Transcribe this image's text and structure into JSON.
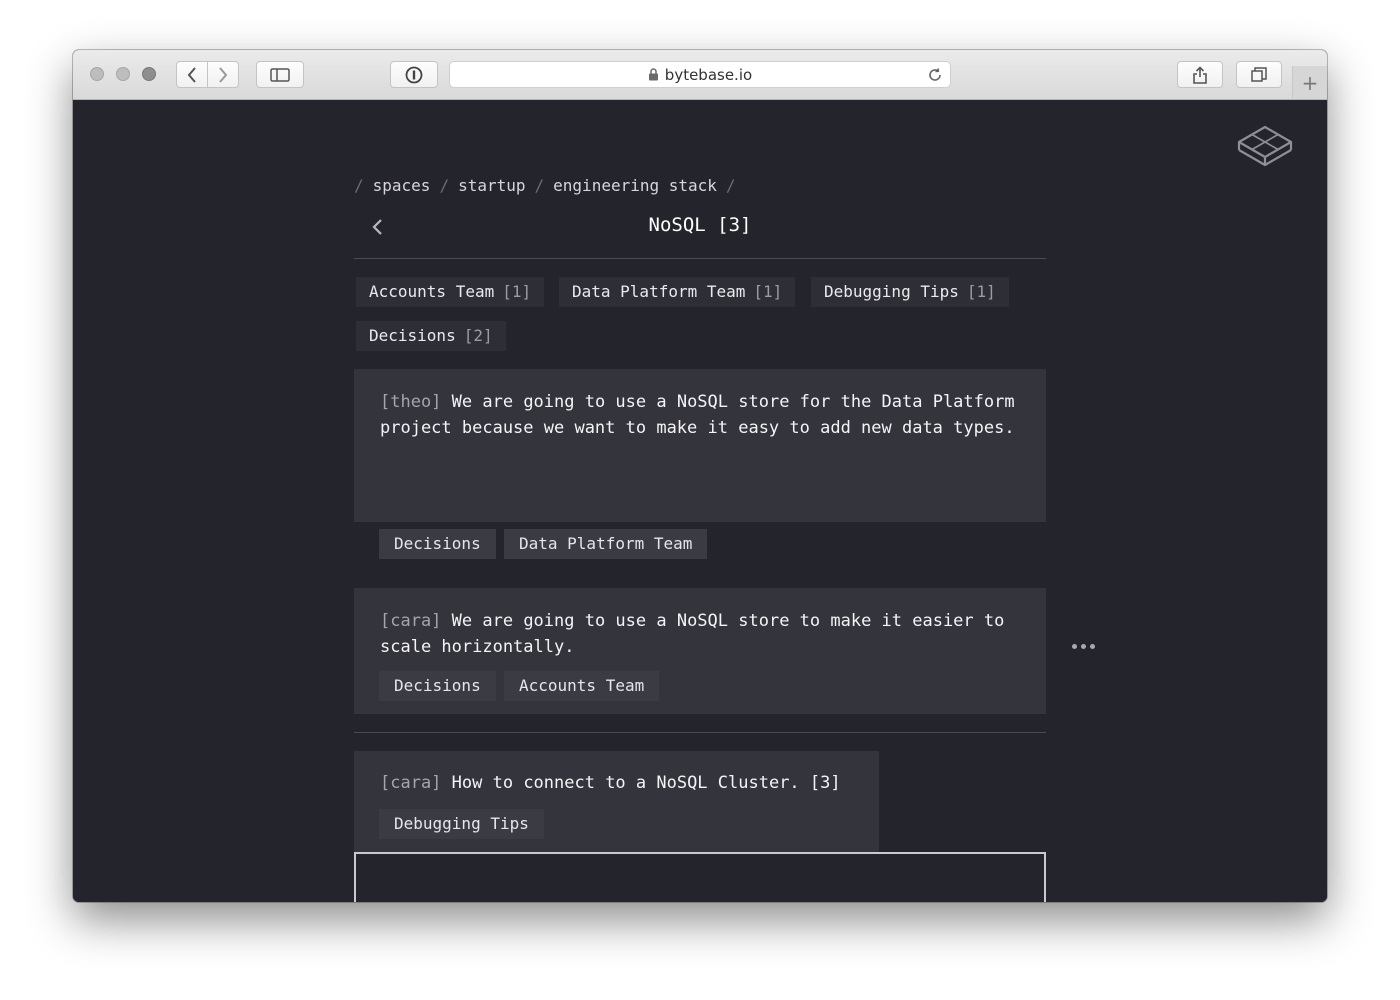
{
  "browser": {
    "url": "bytebase.io",
    "colors": {
      "toolbar": "#e3e3e3",
      "page_bg": "#24242d"
    }
  },
  "breadcrumb": [
    "spaces",
    "startup",
    "engineering stack"
  ],
  "page": {
    "title": "NoSQL [3]"
  },
  "filters": [
    {
      "label": "Accounts Team",
      "count": "[1]"
    },
    {
      "label": "Data Platform Team",
      "count": "[1]"
    },
    {
      "label": "Debugging Tips",
      "count": "[1]"
    },
    {
      "label": "Decisions",
      "count": "[2]"
    }
  ],
  "cards": [
    {
      "author": "[theo]",
      "text": "We are going to use a NoSQL store for the Data Platform project because we want to make it easy to add new data types.",
      "tags": [
        "Decisions",
        "Data Platform Team"
      ]
    },
    {
      "author": "[cara]",
      "text": "We are going to use a NoSQL store to make it easier to scale horizontally.",
      "tags": [
        "Decisions",
        "Accounts Team"
      ]
    },
    {
      "author": "[cara]",
      "text": "How to connect to a NoSQL Cluster. [3]",
      "tags": [
        "Debugging Tips"
      ]
    }
  ],
  "composer": {
    "value": ""
  },
  "icons": {
    "logo": "bytebase-logo-icon",
    "back": "chevron-left-icon",
    "more": "more-horizontal-icon"
  }
}
